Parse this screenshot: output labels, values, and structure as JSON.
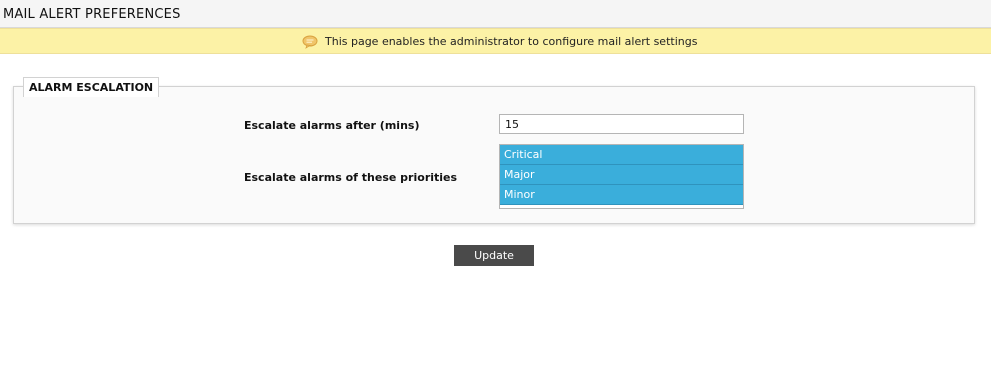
{
  "header": {
    "title": "MAIL ALERT PREFERENCES"
  },
  "info_bar": {
    "icon": "speech-bubble-icon",
    "text": "This page enables the administrator to configure mail alert settings",
    "background_color": "#fcf2a6"
  },
  "alarm_escalation": {
    "legend": "ALARM ESCALATION",
    "escalate_after": {
      "label": "Escalate alarms after (mins)",
      "value": "15"
    },
    "priorities": {
      "label": "Escalate alarms of these priorities",
      "options": [
        "Critical",
        "Major",
        "Minor"
      ],
      "selected": [
        "Critical",
        "Major",
        "Minor"
      ],
      "selected_color": "#3aaedb"
    }
  },
  "actions": {
    "update_label": "Update"
  }
}
